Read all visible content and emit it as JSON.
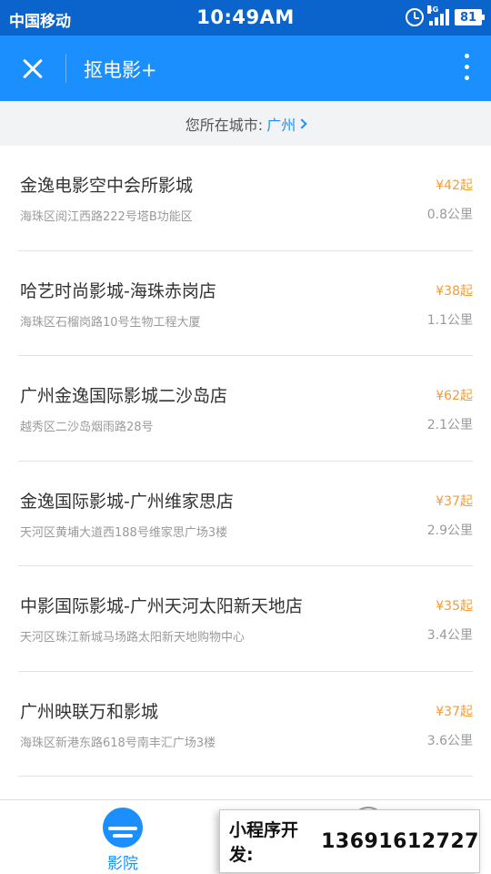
{
  "status_bar": {
    "carrier": "中国移动",
    "time": "10:49AM",
    "network": "4G",
    "battery": "81"
  },
  "nav": {
    "title": "抠电影+"
  },
  "city_bar": {
    "label": "您所在城市:",
    "city": "广州"
  },
  "cinemas": [
    {
      "name": "金逸电影空中会所影城",
      "address": "海珠区阅江西路222号塔B功能区",
      "price": "¥42起",
      "distance": "0.8公里"
    },
    {
      "name": "哈艺时尚影城-海珠赤岗店",
      "address": "海珠区石榴岗路10号生物工程大厦",
      "price": "¥38起",
      "distance": "1.1公里"
    },
    {
      "name": "广州金逸国际影城二沙岛店",
      "address": "越秀区二沙岛烟雨路28号",
      "price": "¥62起",
      "distance": "2.1公里"
    },
    {
      "name": "金逸国际影城-广州维家思店",
      "address": "天河区黄埔大道西188号维家思广场3楼",
      "price": "¥37起",
      "distance": "2.9公里"
    },
    {
      "name": "中影国际影城-广州天河太阳新天地店",
      "address": "天河区珠江新城马场路太阳新天地购物中心",
      "price": "¥35起",
      "distance": "3.4公里"
    },
    {
      "name": "广州映联万和影城",
      "address": "海珠区新港东路618号南丰汇广场3楼",
      "price": "¥37起",
      "distance": "3.6公里"
    }
  ],
  "tab_bar": {
    "cinema_label": "影院"
  },
  "banner": {
    "label": "小程序开发:",
    "phone": "13691612727"
  },
  "colors": {
    "status_bar": "#0b64cc",
    "nav_bar": "#1a8ffd",
    "accent": "#1a8ffd",
    "price": "#f39c3a"
  }
}
